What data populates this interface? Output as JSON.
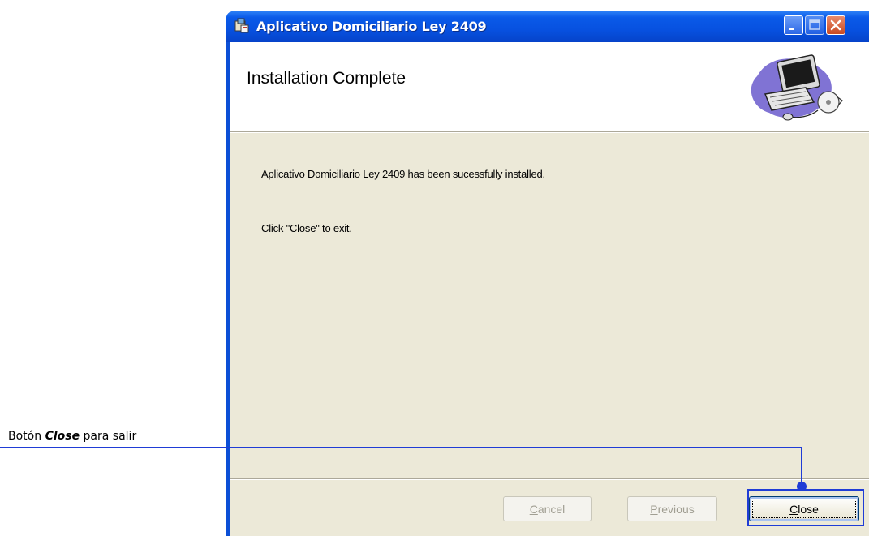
{
  "window": {
    "title": "Aplicativo Domiciliario Ley 2409",
    "colors": {
      "titlebar": "#0a5ae8",
      "client": "#ece9d8",
      "close_button": "#c94a22"
    }
  },
  "banner": {
    "title": "Installation Complete",
    "art_icon": "computer-setup-icon"
  },
  "messages": {
    "installed": "Aplicativo Domiciliario Ley 2409 has been sucessfully installed.",
    "exit_hint": "Click \"Close\" to exit."
  },
  "buttons": {
    "cancel": {
      "label": "Cancel",
      "mnemonic": "C",
      "rest": "ancel",
      "enabled": false
    },
    "previous": {
      "label": "Previous",
      "mnemonic": "P",
      "rest": "revious",
      "enabled": false
    },
    "close": {
      "label": "Close",
      "mnemonic": "C",
      "rest": "lose",
      "enabled": true
    }
  },
  "annotation": {
    "prefix": "Botón ",
    "emphasis": "Close",
    "suffix": " para salir",
    "color": "#1f3cd6"
  }
}
